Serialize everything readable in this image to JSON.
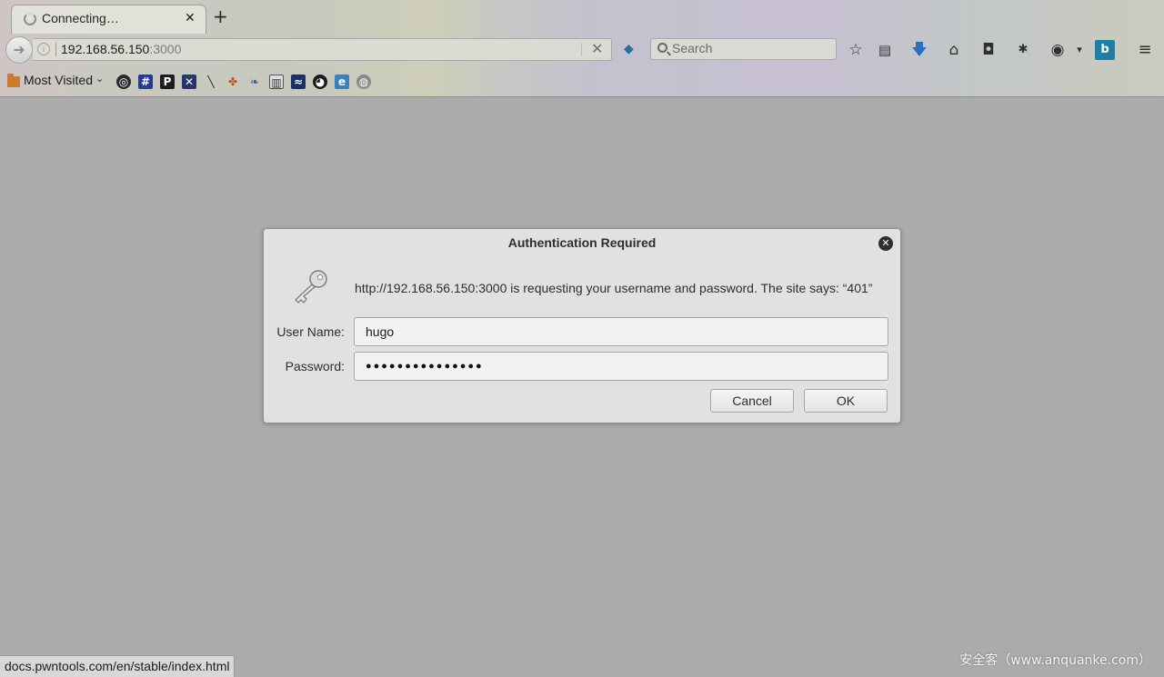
{
  "browser": {
    "tab": {
      "title": "Connecting…"
    },
    "address": {
      "host": "192.168.56.150",
      "port": ":3000"
    },
    "search": {
      "placeholder": "Search"
    },
    "bookmarks": {
      "most_visited_label": "Most Visited"
    },
    "status_url": "docs.pwntools.com/en/stable/index.html"
  },
  "dialog": {
    "title": "Authentication Required",
    "message": "http://192.168.56.150:3000 is requesting your username and password. The site says: “401”",
    "username_label": "User Name:",
    "username_value": "hugo",
    "password_label": "Password:",
    "password_mask": "●●●●●●●●●●●●●●●",
    "cancel_label": "Cancel",
    "ok_label": "OK"
  },
  "watermark": "安全客（www.anquanke.com）",
  "icons": {
    "toolbar": [
      "bird-extension-icon",
      "bookmark-star-icon",
      "reading-list-icon",
      "downloads-icon",
      "home-icon",
      "pocket-icon",
      "spider-extension-icon",
      "shield-extension-icon",
      "bing-icon",
      "hamburger-menu-icon"
    ],
    "bookmarks": [
      "bookmark-circle-icon",
      "bookmark-hash-icon",
      "bookmark-p-icon",
      "bookmark-x-icon",
      "bookmark-knife-icon",
      "bookmark-bug-icon",
      "bookmark-feather-icon",
      "bookmark-book-icon",
      "bookmark-wave-icon",
      "github-icon",
      "bookmark-e-icon",
      "globe-icon"
    ]
  }
}
